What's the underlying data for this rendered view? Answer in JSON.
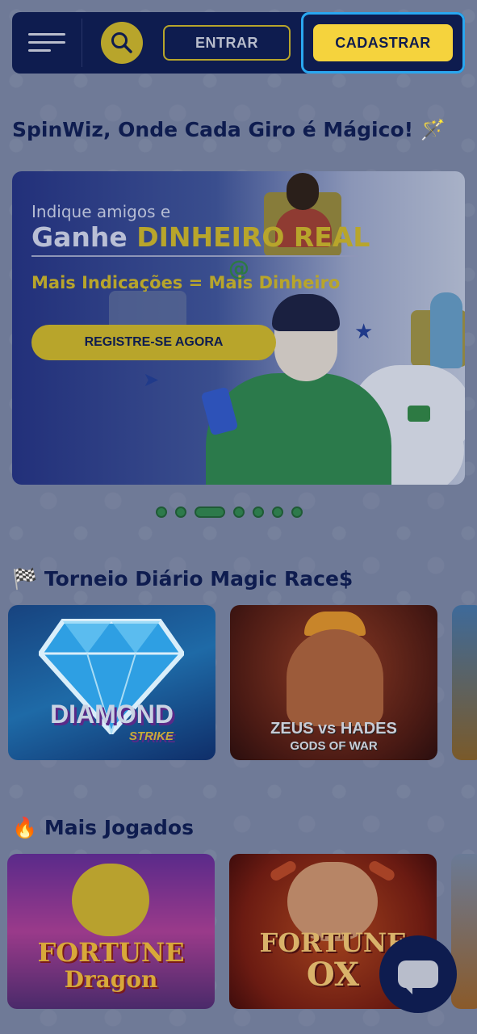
{
  "header": {
    "menu_icon": "hamburger-menu-icon",
    "search_icon": "search-icon",
    "login_label": "ENTRAR",
    "register_label": "CADASTRAR"
  },
  "tagline": "SpinWiz, Onde Cada Giro é Mágico! 🪄",
  "banner": {
    "line1": "Indique amigos e",
    "line2_white": "Ganhe ",
    "line2_yellow": "DINHEIRO REAL",
    "line3": "Mais Indicações = Mais Dinheiro",
    "cta": "REGISTRE-SE AGORA"
  },
  "carousel": {
    "dot_count": 7,
    "active_index": 2
  },
  "sections": [
    {
      "icon": "🏁",
      "title": "Torneio Diário Magic Race$",
      "games": [
        {
          "title": "DIAMOND",
          "subtitle": "STRIKE"
        },
        {
          "title": "ZEUS vs HADES",
          "subtitle": "GODS OF WAR"
        }
      ]
    },
    {
      "icon": "🔥",
      "title": "Mais Jogados",
      "games": [
        {
          "title": "FORTUNE",
          "subtitle": "Dragon"
        },
        {
          "title": "FORTUNE",
          "subtitle": "OX"
        }
      ]
    }
  ],
  "colors": {
    "navy": "#0e1c4f",
    "yellow": "#f5d33d",
    "highlight_border": "#2aa7f0"
  },
  "chat_icon": "chat-bubble-icon"
}
